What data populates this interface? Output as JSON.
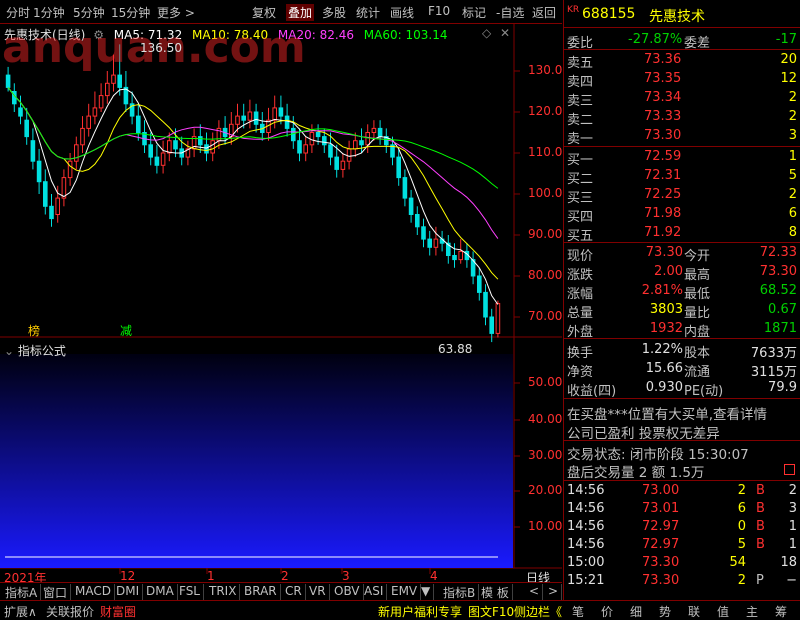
{
  "toolbar": {
    "left_items": [
      "分时",
      "1分钟",
      "5分钟",
      "15分钟",
      "更多 >"
    ],
    "right_items": [
      "复权",
      "叠加",
      "多股",
      "统计",
      "画线",
      "F10",
      "标记",
      "-自选",
      "返回"
    ]
  },
  "chart": {
    "title": "先惠技术(日线)",
    "ma_labels": [
      {
        "label": "MA5: 71.32",
        "color": "#ffffff"
      },
      {
        "label": "MA10: 78.40",
        "color": "#ffff00"
      },
      {
        "label": "MA20: 82.46",
        "color": "#ff40ff"
      },
      {
        "label": "MA60: 103.14",
        "color": "#00ff00"
      }
    ],
    "price_axis": [
      "130.0",
      "120.0",
      "110.0",
      "100.0",
      "90.00",
      "80.00",
      "70.00"
    ],
    "high_label": "136.50",
    "low_label": "63.88",
    "markers": [
      {
        "text": "榜",
        "color": "#ffcc00"
      },
      {
        "text": "减",
        "color": "#00ff00"
      }
    ],
    "indicator_title": "指标公式",
    "indicator_axis": [
      "50.00",
      "40.00",
      "30.00",
      "20.00",
      "10.00"
    ],
    "time_axis": [
      "2021年",
      "12",
      "1",
      "2",
      "3",
      "4"
    ],
    "watermark": "anquan.com",
    "right_button": "日线",
    "plus": "+",
    "minus": "−"
  },
  "candles": [
    [
      129,
      126,
      131,
      125
    ],
    [
      125,
      122,
      127,
      120
    ],
    [
      121,
      119,
      124,
      117
    ],
    [
      118,
      114,
      121,
      112
    ],
    [
      113,
      108,
      116,
      106
    ],
    [
      108,
      103,
      111,
      100
    ],
    [
      103,
      97,
      106,
      95
    ],
    [
      97,
      94,
      100,
      92
    ],
    [
      95,
      99,
      102,
      93
    ],
    [
      99,
      104,
      106,
      97
    ],
    [
      104,
      108,
      110,
      102
    ],
    [
      108,
      112,
      114,
      106
    ],
    [
      112,
      116,
      119,
      110
    ],
    [
      116,
      119,
      122,
      114
    ],
    [
      119,
      121,
      125,
      117
    ],
    [
      121,
      124,
      127,
      120
    ],
    [
      124,
      127,
      130,
      122
    ],
    [
      127,
      129,
      134,
      125
    ],
    [
      129,
      126,
      136.5,
      124
    ],
    [
      126,
      122,
      130,
      120
    ],
    [
      122,
      119,
      125,
      117
    ],
    [
      119,
      115,
      122,
      113
    ],
    [
      115,
      112,
      118,
      110
    ],
    [
      112,
      109,
      115,
      107
    ],
    [
      109,
      107,
      112,
      105
    ],
    [
      107,
      110,
      113,
      105
    ],
    [
      110,
      113,
      115,
      108
    ],
    [
      113,
      111,
      116,
      109
    ],
    [
      111,
      109,
      114,
      107
    ],
    [
      109,
      111,
      113,
      107
    ],
    [
      111,
      114,
      116,
      109
    ],
    [
      114,
      112,
      117,
      110
    ],
    [
      112,
      110,
      115,
      108
    ],
    [
      110,
      113,
      115,
      108
    ],
    [
      113,
      116,
      118,
      111
    ],
    [
      116,
      114,
      119,
      112
    ],
    [
      114,
      117,
      120,
      112
    ],
    [
      117,
      119,
      122,
      115
    ],
    [
      119,
      118,
      122,
      116
    ],
    [
      118,
      120,
      123,
      116
    ],
    [
      120,
      117,
      122,
      115
    ],
    [
      117,
      115,
      120,
      113
    ],
    [
      115,
      118,
      121,
      113
    ],
    [
      118,
      121,
      124,
      116
    ],
    [
      121,
      119,
      124,
      117
    ],
    [
      119,
      116,
      122,
      114
    ],
    [
      116,
      113,
      119,
      111
    ],
    [
      113,
      110,
      116,
      108
    ],
    [
      110,
      112,
      114,
      108
    ],
    [
      112,
      115,
      117,
      110
    ],
    [
      115,
      114,
      117,
      112
    ],
    [
      114,
      112,
      116,
      110
    ],
    [
      112,
      109,
      115,
      107
    ],
    [
      109,
      106,
      112,
      104
    ],
    [
      106,
      108,
      110,
      104
    ],
    [
      108,
      111,
      113,
      106
    ],
    [
      111,
      113,
      115,
      109
    ],
    [
      113,
      112,
      116,
      110
    ],
    [
      112,
      115,
      117,
      110
    ],
    [
      115,
      116,
      118,
      113
    ],
    [
      116,
      114,
      118,
      112
    ],
    [
      114,
      112,
      116,
      110
    ],
    [
      112,
      109,
      114,
      107
    ],
    [
      109,
      104,
      111,
      102
    ],
    [
      104,
      99,
      106,
      97
    ],
    [
      99,
      95,
      101,
      93
    ],
    [
      95,
      92,
      97,
      90
    ],
    [
      92,
      89,
      94,
      87
    ],
    [
      89,
      87,
      91,
      85
    ],
    [
      87,
      89,
      92,
      85
    ],
    [
      89,
      88,
      91,
      86
    ],
    [
      88,
      85,
      90,
      83
    ],
    [
      85,
      84,
      88,
      82
    ],
    [
      84,
      86,
      89,
      83
    ],
    [
      86,
      84,
      88,
      82
    ],
    [
      84,
      80,
      86,
      78
    ],
    [
      80,
      76,
      82,
      74
    ],
    [
      76,
      70,
      78,
      68
    ],
    [
      70,
      66,
      72,
      63.88
    ],
    [
      66,
      73.3,
      74,
      65
    ]
  ],
  "panel": {
    "code": "688155",
    "name": "先惠技术",
    "badge": "KR",
    "weibi_label": "委比",
    "weibi": "-27.87%",
    "weicha_label": "委差",
    "weicha": "-17",
    "asks": [
      {
        "label": "卖五",
        "price": "73.36",
        "vol": "20"
      },
      {
        "label": "卖四",
        "price": "73.35",
        "vol": "12"
      },
      {
        "label": "卖三",
        "price": "73.34",
        "vol": "2"
      },
      {
        "label": "卖二",
        "price": "73.33",
        "vol": "2"
      },
      {
        "label": "卖一",
        "price": "73.30",
        "vol": "3"
      }
    ],
    "bids": [
      {
        "label": "买一",
        "price": "72.59",
        "vol": "1"
      },
      {
        "label": "买二",
        "price": "72.31",
        "vol": "5"
      },
      {
        "label": "买三",
        "price": "72.25",
        "vol": "2"
      },
      {
        "label": "买四",
        "price": "71.98",
        "vol": "6"
      },
      {
        "label": "买五",
        "price": "71.92",
        "vol": "8"
      }
    ],
    "quote": [
      {
        "l1": "现价",
        "v1": "73.30",
        "c1": "#ff3030",
        "l2": "今开",
        "v2": "72.33",
        "c2": "#ff3030"
      },
      {
        "l1": "涨跌",
        "v1": "2.00",
        "c1": "#ff3030",
        "l2": "最高",
        "v2": "73.30",
        "c2": "#ff3030"
      },
      {
        "l1": "涨幅",
        "v1": "2.81%",
        "c1": "#ff3030",
        "l2": "最低",
        "v2": "68.52",
        "c2": "#00d000"
      },
      {
        "l1": "总量",
        "v1": "3803",
        "c1": "#ffff00",
        "l2": "量比",
        "v2": "0.67",
        "c2": "#00d000"
      },
      {
        "l1": "外盘",
        "v1": "1932",
        "c1": "#ff3030",
        "l2": "内盘",
        "v2": "1871",
        "c2": "#00d000"
      }
    ],
    "fund": [
      {
        "l1": "换手",
        "v1": "1.22%",
        "l2": "股本",
        "v2": "7633万"
      },
      {
        "l1": "净资",
        "v1": "15.66",
        "l2": "流通",
        "v2": "3115万"
      },
      {
        "l1": "收益(四)",
        "v1": "0.930",
        "l2": "PE(动)",
        "v2": "79.9"
      }
    ],
    "news1": "在买盘***位置有大买单,查看详情",
    "news2": "公司已盈利 投票权无差异",
    "status": "交易状态: 闭市阶段 15:30:07",
    "after": "盘后交易量 2 额 1.5万",
    "trades": [
      {
        "t": "14:56",
        "p": "73.00",
        "pc": "#ff3030",
        "v": "2",
        "s": "B",
        "sc": "#ff3030",
        "n": "2"
      },
      {
        "t": "14:56",
        "p": "73.01",
        "pc": "#ff3030",
        "v": "6",
        "s": "B",
        "sc": "#ff3030",
        "n": "3"
      },
      {
        "t": "14:56",
        "p": "72.97",
        "pc": "#ff3030",
        "v": "0",
        "s": "B",
        "sc": "#ff3030",
        "n": "1"
      },
      {
        "t": "14:56",
        "p": "72.97",
        "pc": "#ff3030",
        "v": "5",
        "s": "B",
        "sc": "#ff3030",
        "n": "1"
      },
      {
        "t": "15:00",
        "p": "73.30",
        "pc": "#ff3030",
        "v": "54",
        "s": "",
        "sc": "#ff3030",
        "n": "18"
      },
      {
        "t": "15:21",
        "p": "73.30",
        "pc": "#ff3030",
        "v": "2",
        "s": "P",
        "sc": "#c0c0c0",
        "n": "−"
      }
    ]
  },
  "bottom_tabs": [
    "指标A",
    "窗口",
    "MACD",
    "DMI",
    "DMA",
    "FSL",
    "TRIX",
    "BRAR",
    "CR",
    "VR",
    "OBV",
    "ASI",
    "EMV",
    "▼",
    "指标B",
    "模 板",
    "<",
    ">"
  ],
  "footer": {
    "left": [
      "扩展∧",
      "关联报价",
      "财富圈"
    ],
    "mid": [
      "新用户福利专享",
      "图文F10",
      "侧边栏《"
    ],
    "right": [
      "笔",
      "价",
      "细",
      "势",
      "联",
      "值",
      "主",
      "筹"
    ]
  }
}
